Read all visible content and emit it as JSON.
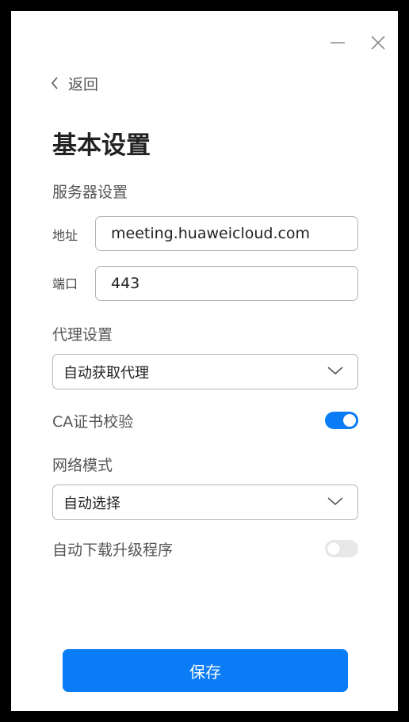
{
  "window": {
    "back_label": "返回",
    "title": "基本设置"
  },
  "server": {
    "section_label": "服务器设置",
    "address_label": "地址",
    "address_value": "meeting.huaweicloud.com",
    "port_label": "端口",
    "port_value": "443"
  },
  "proxy": {
    "section_label": "代理设置",
    "selected": "自动获取代理"
  },
  "ca_verify": {
    "label": "CA证书校验",
    "enabled": true
  },
  "network": {
    "section_label": "网络模式",
    "selected": "自动选择"
  },
  "auto_upgrade": {
    "label": "自动下载升级程序",
    "enabled": false
  },
  "actions": {
    "save_label": "保存"
  },
  "colors": {
    "accent": "#0a7cf5",
    "window_bg": "#ffffff",
    "border": "#b4b4b4"
  },
  "icons": {
    "minimize": "minimize-icon",
    "close": "close-icon",
    "back": "chevron-left-icon",
    "dropdown": "chevron-down-icon"
  }
}
